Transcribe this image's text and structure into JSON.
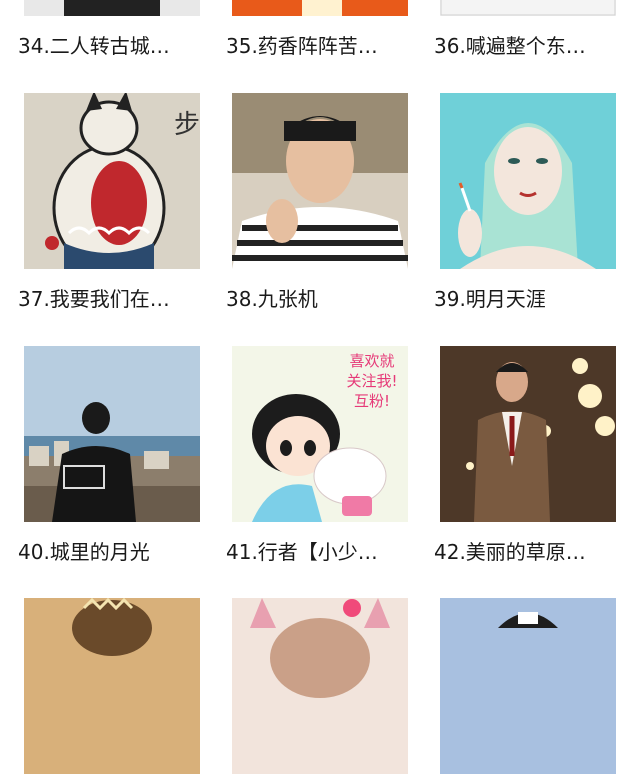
{
  "grid": {
    "items": [
      {
        "label": "34.二人转古城…",
        "thumb": "partial-image"
      },
      {
        "label": "35.药香阵阵苦…",
        "thumb": "partial-image"
      },
      {
        "label": "36.喊遍整个东…",
        "thumb": "partial-image"
      },
      {
        "label": "37.我要我们在…",
        "thumb": "tattoo-cat-koi"
      },
      {
        "label": "38.九张机",
        "thumb": "man-striped-shirt"
      },
      {
        "label": "39.明月天涯",
        "thumb": "anime-girl-smoking"
      },
      {
        "label": "40.城里的月光",
        "thumb": "man-seaside-city"
      },
      {
        "label": "41.行者【小少…",
        "thumb": "cartoon-girl-follow-me",
        "thumb_text": [
          "喜欢就",
          "关注我!",
          "互粉!"
        ]
      },
      {
        "label": "42.美丽的草原…",
        "thumb": "man-in-suit"
      },
      {
        "label": "",
        "thumb": "partial-image"
      },
      {
        "label": "",
        "thumb": "partial-image"
      },
      {
        "label": "",
        "thumb": "partial-image"
      }
    ]
  }
}
